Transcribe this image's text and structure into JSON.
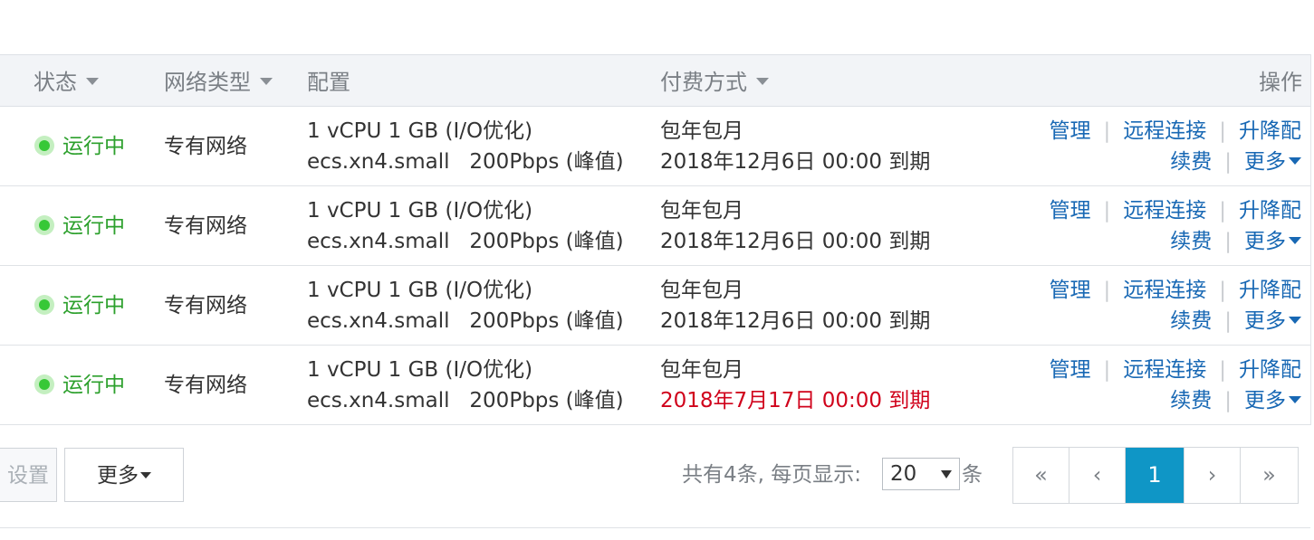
{
  "columns": {
    "status": "状态",
    "network": "网络类型",
    "config": "配置",
    "billing": "付费方式",
    "ops": "操作"
  },
  "rows": [
    {
      "status": "运行中",
      "network": "专有网络",
      "config_line1": "1 vCPU 1 GB (I/O优化)",
      "config_line2": "ecs.xn4.small   200Pbps (峰值)",
      "billing_type": "包年包月",
      "expire": "2018年12月6日 00:00 到期",
      "expire_warning": false
    },
    {
      "status": "运行中",
      "network": "专有网络",
      "config_line1": "1 vCPU 1 GB (I/O优化)",
      "config_line2": "ecs.xn4.small   200Pbps (峰值)",
      "billing_type": "包年包月",
      "expire": "2018年12月6日 00:00 到期",
      "expire_warning": false
    },
    {
      "status": "运行中",
      "network": "专有网络",
      "config_line1": "1 vCPU 1 GB (I/O优化)",
      "config_line2": "ecs.xn4.small   200Pbps (峰值)",
      "billing_type": "包年包月",
      "expire": "2018年12月6日 00:00 到期",
      "expire_warning": false
    },
    {
      "status": "运行中",
      "network": "专有网络",
      "config_line1": "1 vCPU 1 GB (I/O优化)",
      "config_line2": "ecs.xn4.small   200Pbps (峰值)",
      "billing_type": "包年包月",
      "expire": "2018年7月17日 00:00 到期",
      "expire_warning": true
    }
  ],
  "actions": {
    "manage": "管理",
    "remote": "远程连接",
    "upgrade": "升降配",
    "renew": "续费",
    "more": "更多",
    "separator": "|"
  },
  "footer": {
    "settings_button": "设置",
    "more_button": "更多",
    "summary": "共有4条, 每页显示:",
    "page_size": "20",
    "unit": "条"
  },
  "pagination": {
    "first": "«",
    "prev": "‹",
    "current": "1",
    "next": "›",
    "last": "»"
  },
  "colors": {
    "running": "#2ca02c",
    "link": "#1868b4",
    "warning": "#d0021b",
    "active_page": "#0f96c6"
  }
}
